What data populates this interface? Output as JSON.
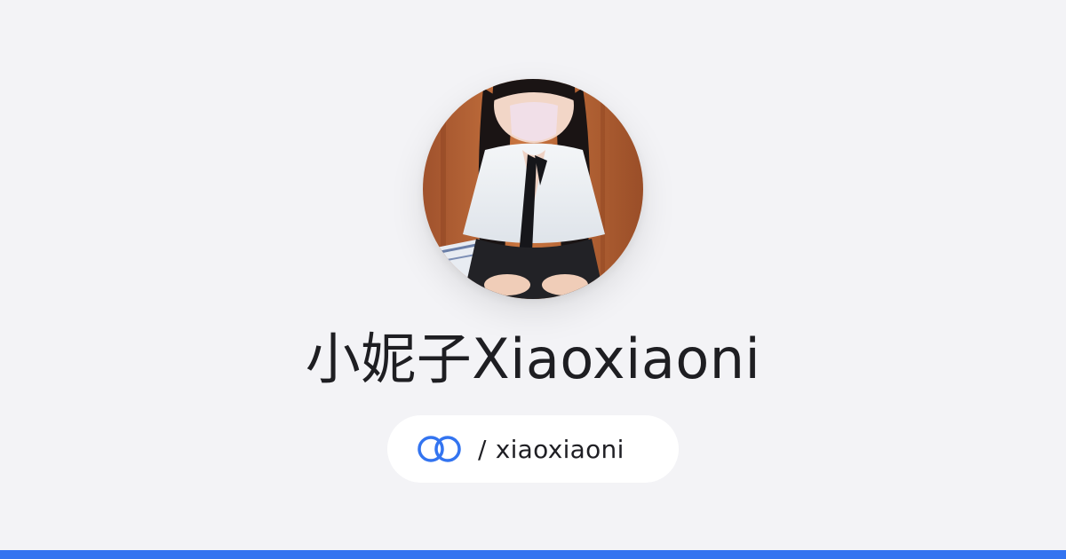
{
  "profile": {
    "display_name": "小妮子Xiaoxiaoni",
    "avatar_alt": "avatar",
    "handle_separator": "/",
    "handle": "xiaoxiaoni"
  },
  "icons": {
    "brand": "linked-rings-icon"
  },
  "colors": {
    "background": "#f3f3f6",
    "accent": "#3374f0",
    "name_text": "#1e1e22",
    "pill_background": "#ffffff"
  }
}
